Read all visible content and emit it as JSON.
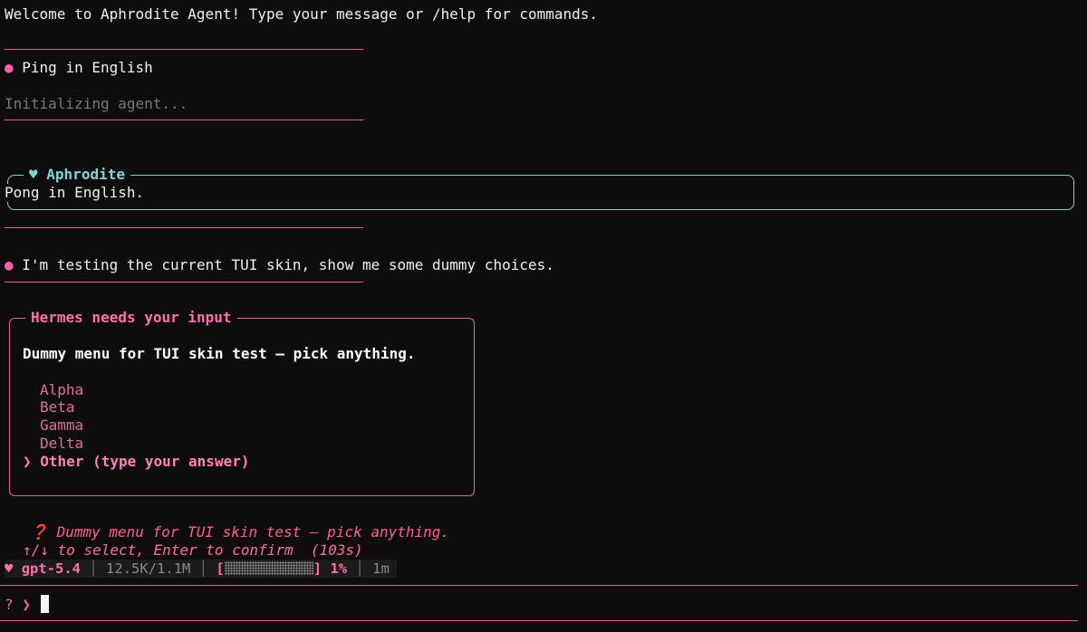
{
  "welcome": "Welcome to Aphrodite Agent! Type your message or /help for commands.",
  "bullet": "●",
  "heart": "♥",
  "messages": {
    "user1": "Ping in English",
    "status_initializing": "Initializing agent...",
    "assistant_name": "Aphrodite",
    "assistant_reply": "Pong in English.",
    "user2": "I'm testing the current TUI skin, show me some dummy choices."
  },
  "input_panel": {
    "title": "Hermes needs your input",
    "question": "Dummy menu for TUI skin test — pick anything.",
    "options": [
      "Alpha",
      "Beta",
      "Gamma",
      "Delta"
    ],
    "selected_marker": "❯",
    "selected_option": "Other (type your answer)"
  },
  "prompt": {
    "icon": "❓",
    "question": "Dummy menu for TUI skin test — pick anything.",
    "hint": "↑/↓ to select, Enter to confirm  (103s)"
  },
  "status_bar": {
    "model": "gpt-5.4",
    "tokens": "12.5K/1.1M",
    "bracket_open": "[",
    "bracket_close": "]",
    "progress_percent": 1,
    "percent_label": "1%",
    "elapsed": "1m"
  },
  "input": {
    "prompt": "? ❯",
    "value": ""
  },
  "colors": {
    "accent_pink": "#e0609a",
    "accent_cyan": "#7fd4d4",
    "background": "#0e0c0d"
  }
}
